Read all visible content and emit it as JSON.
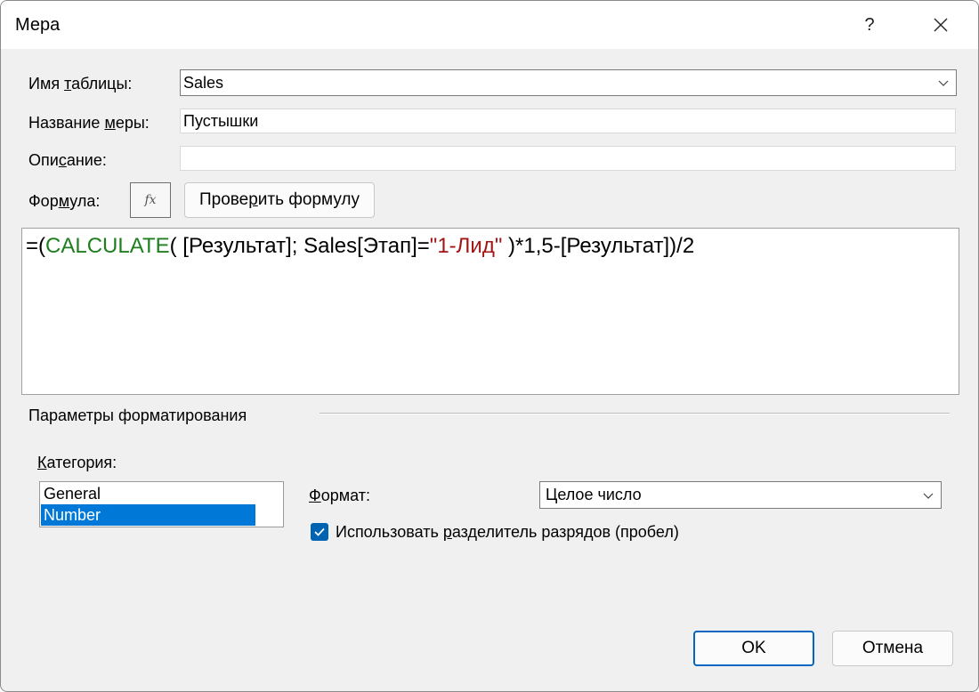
{
  "window": {
    "title": "Мера",
    "help_label": "?",
    "close_label": "✕"
  },
  "table_name": {
    "label_pre": "Имя ",
    "label_accel": "т",
    "label_post": "аблицы:",
    "value": "Sales"
  },
  "measure_name": {
    "label_pre": "Название ",
    "label_accel": "м",
    "label_post": "еры:",
    "value": "Пустышки"
  },
  "description": {
    "label_pre": "Опи",
    "label_accel": "с",
    "label_post": "ание:",
    "value": ""
  },
  "formula": {
    "label_pre": "Фор",
    "label_accel": "м",
    "label_post": "ула:",
    "fx_label": "fx",
    "check_pre": "Прове",
    "check_accel": "р",
    "check_post": "ить формулу",
    "tokens": {
      "t1": "=(",
      "t2": "CALCULATE",
      "t3": "( [Результат]; Sales[Этап]=",
      "t4": "\"1-Лид\"",
      "t5": " )*1,5-[Результат])/2"
    }
  },
  "formatting": {
    "group_title": "Параметры форматирования",
    "category_accel": "К",
    "category_post": "атегория:",
    "categories": [
      "General",
      "Number"
    ],
    "selected_category": "Number",
    "format_accel": "Ф",
    "format_post": "ормат:",
    "format_value": "Целое число",
    "separator_pre": "Использовать ",
    "separator_accel": "р",
    "separator_post": "азделитель разрядов (пробел)",
    "separator_checked": true
  },
  "buttons": {
    "ok": "OK",
    "cancel": "Отмена"
  },
  "colors": {
    "accent": "#0078d7",
    "keyword": "#1f7f1f",
    "string": "#a31515"
  }
}
